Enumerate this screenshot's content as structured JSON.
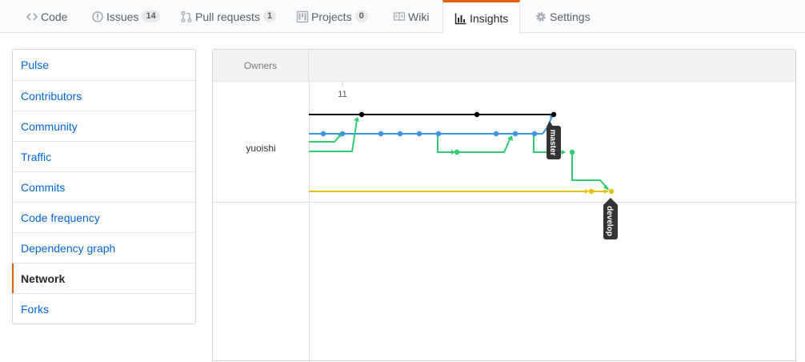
{
  "repo_nav": {
    "tabs": [
      {
        "label": "Code",
        "icon": "code-icon",
        "counter": null
      },
      {
        "label": "Issues",
        "icon": "issue-icon",
        "counter": "14"
      },
      {
        "label": "Pull requests",
        "icon": "pull-request-icon",
        "counter": "1"
      },
      {
        "label": "Projects",
        "icon": "project-icon",
        "counter": "0"
      },
      {
        "label": "Wiki",
        "icon": "book-icon",
        "counter": null
      },
      {
        "label": "Insights",
        "icon": "graph-icon",
        "counter": null,
        "selected": true
      },
      {
        "label": "Settings",
        "icon": "gear-icon",
        "counter": null
      }
    ],
    "accent_color": "#e36209"
  },
  "sidebar": {
    "items": [
      {
        "label": "Pulse"
      },
      {
        "label": "Contributors"
      },
      {
        "label": "Community"
      },
      {
        "label": "Traffic"
      },
      {
        "label": "Commits"
      },
      {
        "label": "Code frequency"
      },
      {
        "label": "Dependency graph"
      },
      {
        "label": "Network",
        "selected": true
      },
      {
        "label": "Forks"
      }
    ]
  },
  "network": {
    "owners_header": "Owners",
    "owner": "yuoishi",
    "date_label": "11",
    "branches": [
      {
        "label": "master",
        "color": "#000000"
      },
      {
        "label": "develop",
        "color": "#e8c212"
      }
    ],
    "lane_colors": [
      "#000000",
      "#3d94e0",
      "#2fcc71",
      "#e8c212"
    ]
  }
}
